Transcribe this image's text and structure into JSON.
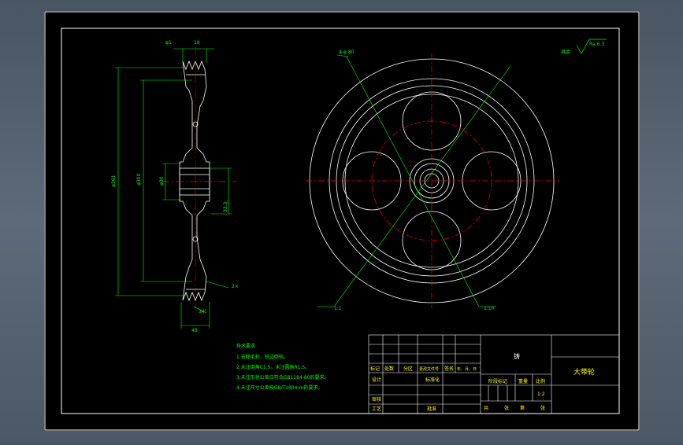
{
  "colors": {
    "background": "#000000",
    "frame": "#ffffff",
    "dimension": "#00ff00",
    "centerline": "#ff0000",
    "title_text": "#ffff00",
    "window_bg": "#5a6676"
  },
  "annotations": {
    "roughness": "其余",
    "roughness_value": "Ra 6.3",
    "side_dim_top_left": "φ1",
    "side_dim_top_right": "18",
    "side_dim_outer": "φ361",
    "side_dim_inner": "φ300",
    "side_dim_bore": "φ30",
    "side_dim_keyway": "8",
    "side_dim_hub": "33.3",
    "side_dim_angle": "34°",
    "side_dim_groove": "2×",
    "side_dim_width": "48",
    "front_label_a": "4-φ 80",
    "front_label_b": "1:1",
    "front_label_c": "1:10"
  },
  "tech_requirements": {
    "title": "技术要求",
    "items": [
      "1.去除毛刺，锐边倒钝。",
      "2.未注倒角C1.5，未注圆角R1.5。",
      "3.未注形状公差应符合GB1184-80的要求。",
      "4.未注尺寸公差按GB/T1804-m的要求。"
    ]
  },
  "title_block": {
    "material": "铸",
    "part_name": "大带轮",
    "row_labels": [
      "标记",
      "处数",
      "分区",
      "更改文件号",
      "签名",
      "年、月、日"
    ],
    "design": "设计",
    "standardization": "标准化",
    "stage_marking": "阶段标记",
    "weight": "重量",
    "scale_label": "比例",
    "scale": "1:2",
    "review": "审核",
    "process": "工艺",
    "approve": "批准",
    "sheet_total": "共",
    "sheet_word": "张",
    "sheet_no": "第",
    "sheet_word2": "张"
  }
}
